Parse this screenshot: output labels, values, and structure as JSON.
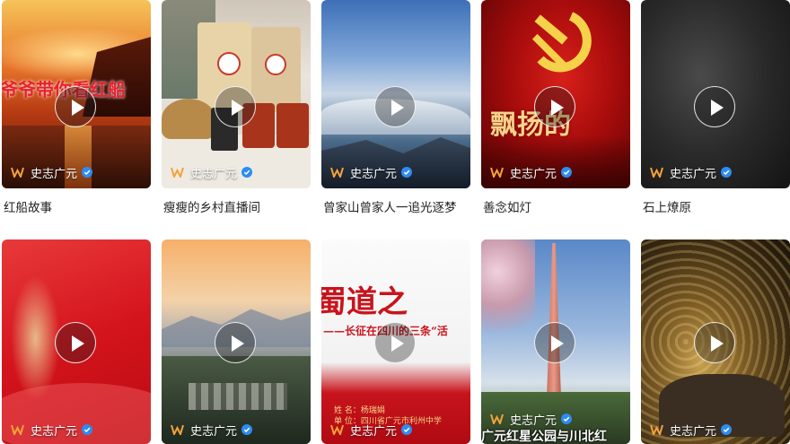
{
  "videos": [
    {
      "title": "红船故事",
      "author": "史志广元",
      "overlay": "爷爷带你看红船"
    },
    {
      "title": "瘦瘦的乡村直播间",
      "author": "史志广元"
    },
    {
      "title": "曾家山曾家人一追光逐梦",
      "author": "史志广元"
    },
    {
      "title": "善念如灯",
      "author": "史志广元",
      "overlay": "飘扬的"
    },
    {
      "title": "石上燎原",
      "author": "史志广元"
    },
    {
      "author": "史志广元"
    },
    {
      "author": "史志广元"
    },
    {
      "author": "史志广元",
      "overlay": "蜀道之",
      "subtitle": "——长征在四川的三条“活",
      "credit_name": "姓 名：杨瑞娟",
      "credit_unit": "单 位：四川省广元市利州中学"
    },
    {
      "author": "史志广元",
      "overlay": "广元红星公园与川北红"
    },
    {
      "author": "史志广元"
    }
  ]
}
